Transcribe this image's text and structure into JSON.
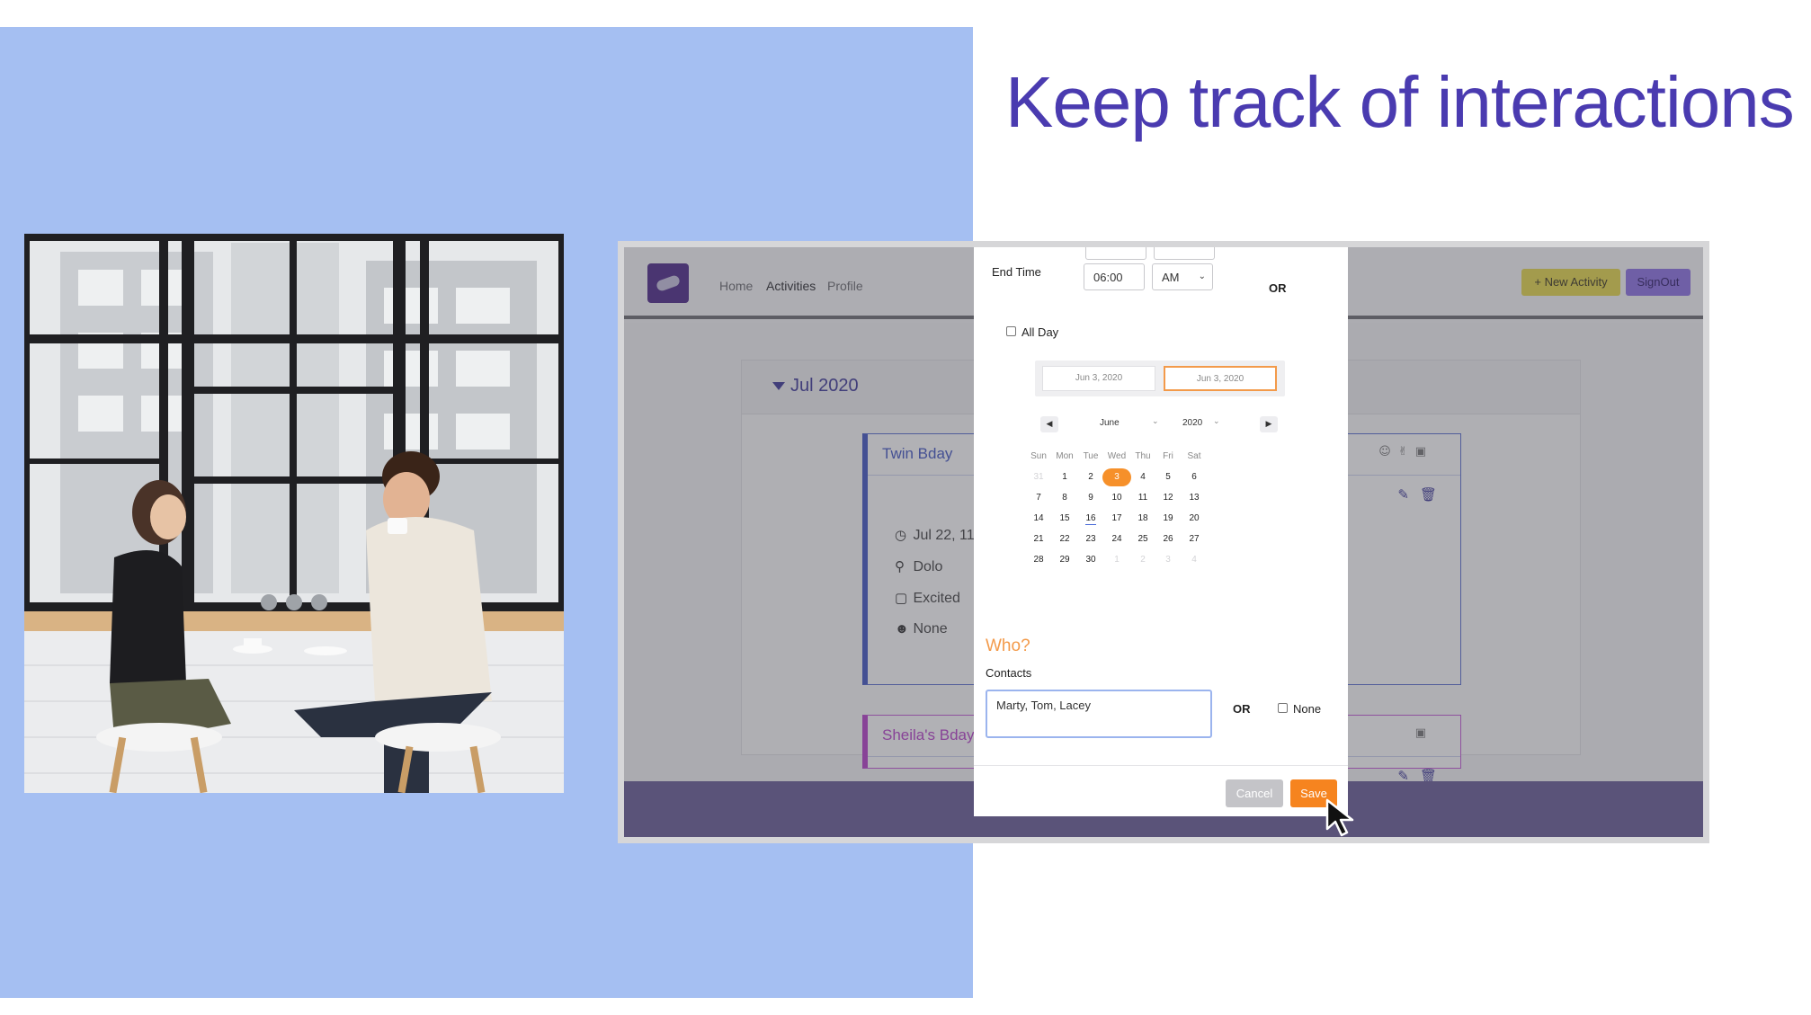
{
  "slide": {
    "headline": "Keep track of interactions",
    "colors": {
      "panel": "#a5bff2",
      "headline": "#4a3bb0"
    }
  },
  "photo": {
    "icon": "people-coffee-photo"
  },
  "app": {
    "nav": {
      "logo_icon": "app-logo-icon",
      "links": [
        "Home",
        "Activities",
        "Profile"
      ],
      "new_activity": "+ New Activity",
      "signout": "SignOut"
    },
    "month": "Jul 2020",
    "cards": [
      {
        "title": "Twin Bday",
        "date": "Jul 22, 11:",
        "location": "Dolo",
        "mood": "Excited",
        "people": "None"
      },
      {
        "title": "Sheila's Bday"
      }
    ],
    "colors": {
      "accent": "#4458c4",
      "card2": "#b842cc",
      "footer": "#6a5e98"
    }
  },
  "modal": {
    "end_time_label": "End Time",
    "end_time_value": "06:00",
    "ampm_value": "AM",
    "or_label": "OR",
    "all_day_label": "All Day",
    "date_start": "Jun 3, 2020",
    "date_end": "Jun 3, 2020",
    "calendar": {
      "month": "June",
      "year": "2020",
      "weekdays": [
        "Sun",
        "Mon",
        "Tue",
        "Wed",
        "Thu",
        "Fri",
        "Sat"
      ],
      "weeks": [
        [
          "31",
          "1",
          "2",
          "3",
          "4",
          "5",
          "6"
        ],
        [
          "7",
          "8",
          "9",
          "10",
          "11",
          "12",
          "13"
        ],
        [
          "14",
          "15",
          "16",
          "17",
          "18",
          "19",
          "20"
        ],
        [
          "21",
          "22",
          "23",
          "24",
          "25",
          "26",
          "27"
        ],
        [
          "28",
          "29",
          "30",
          "1",
          "2",
          "3",
          "4"
        ]
      ],
      "selected_day": "3",
      "today_day": "16"
    },
    "who_heading": "Who?",
    "contacts_label": "Contacts",
    "contacts_value": "Marty, Tom, Lacey",
    "or_label_2": "OR",
    "none_label": "None",
    "cancel": "Cancel",
    "save": "Save",
    "colors": {
      "orange": "#f6841f",
      "selected": "#f6902a"
    }
  }
}
